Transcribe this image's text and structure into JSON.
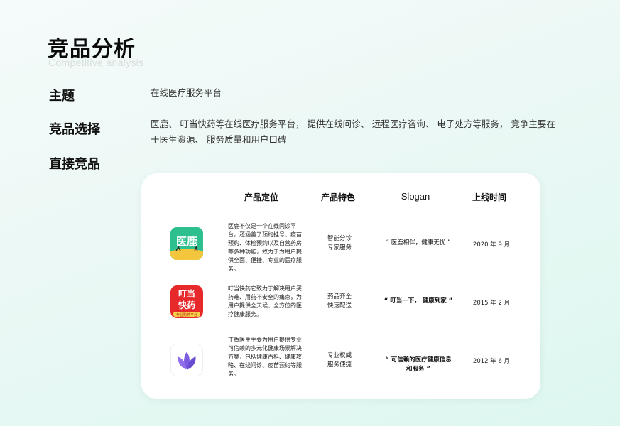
{
  "page": {
    "title": "竞品分析",
    "subtitle": "Competitive analysis"
  },
  "rows": {
    "topic": {
      "label": "主题",
      "text": "在线医疗服务平台"
    },
    "selection": {
      "label": "竞品选择",
      "line1": "医鹿、 叮当快药等在线医疗服务平台， 提供在线问诊、 远程医疗咨询、 电子处方等服务， 竞争主要在",
      "line2": "于医生资源、 服务质量和用户口碑"
    },
    "direct": {
      "label": "直接竞品"
    }
  },
  "table": {
    "headers": {
      "position": "产品定位",
      "features": "产品特色",
      "slogan": "Slogan",
      "launch": "上线时间"
    },
    "products": [
      {
        "icon": "yilu-app-icon",
        "icon_text": "医鹿",
        "description": "医鹿不仅是一个在线问诊平台，还涵盖了预约挂号、疫苗预约、体检预约以及自营药房等多种功能，致力于为用户提供全面、便捷、专业的医疗服务。",
        "features": [
          "智能分诊",
          "专家服务"
        ],
        "slogan": "“ 医鹿相伴，健康无忧 ”",
        "launch": "2020 年 9 月"
      },
      {
        "icon": "dingdang-app-icon",
        "icon_text_top": "叮当",
        "icon_text_mid": "快药",
        "icon_text_bottom": "专业购药平台",
        "description": "叮当快药它致力于解决用户买药难、用药不安全的痛点，为用户提供全天候、全方位的医疗健康服务。",
        "features": [
          "药品齐全",
          "快速配送"
        ],
        "slogan": "“ 叮当一下， 健康到家 ”",
        "launch": "2015 年 2 月"
      },
      {
        "icon": "dingxiang-app-icon",
        "description": "丁香医生主要为用户提供专业可信赖的多元化健康场景解决方案，包括健康百科、健康攻略、在线问诊、疫苗预约等服务。",
        "features": [
          "专业权威",
          "服务便捷"
        ],
        "slogan": "“ 可信赖的医疗健康信息和服务 ”",
        "launch": "2012 年 6 月"
      }
    ]
  },
  "colors": {
    "yilu_green": "#2ebf8f",
    "dingdang_red": "#e8292b",
    "dingxiang_purple": "#7c5ce0"
  }
}
